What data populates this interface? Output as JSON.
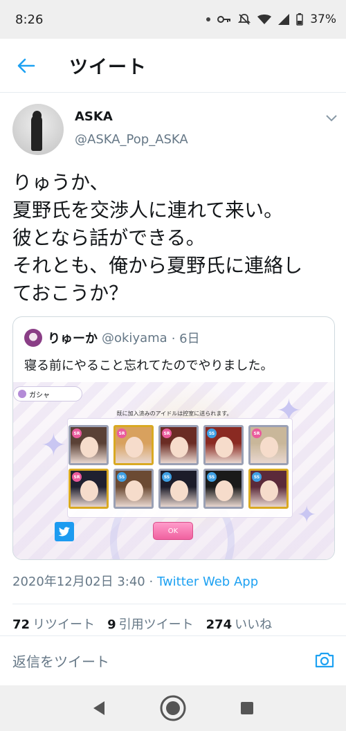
{
  "status_bar": {
    "time": "8:26",
    "battery": "37%"
  },
  "header": {
    "title": "ツイート"
  },
  "tweet": {
    "display_name": "ASKA",
    "handle": "@ASKA_Pop_ASKA",
    "lines": [
      "りゅうか、",
      "夏野氏を交渉人に連れて来い。",
      "彼となら話ができる。",
      "それとも、俺から夏野氏に連絡し",
      "ておこうか？"
    ],
    "timestamp": "2020年12月02日 3:40",
    "separator": " · ",
    "source": "Twitter Web App",
    "retweets_count": "72",
    "retweets_label": "リツイート",
    "quotes_count": "9",
    "quotes_label": "引用ツイート",
    "likes_count": "274",
    "likes_label": "いいね"
  },
  "quote": {
    "display_name": "りゅーか",
    "handle": "@okiyama",
    "age": "· 6日",
    "text": "寝る前にやること忘れてたのでやりました。",
    "image": {
      "tab_label": "ガシャ",
      "notice": "既に加入済みのアイドルは控室に送られます。",
      "ok_label": "OK",
      "cards": [
        {
          "badge": "SR",
          "frame": "silver",
          "hair": "#5a4136"
        },
        {
          "badge": "SR",
          "frame": "gold",
          "hair": "#d8a15e"
        },
        {
          "badge": "SR",
          "frame": "silver",
          "hair": "#6a2c24"
        },
        {
          "badge": "SS",
          "frame": "silver",
          "hair": "#8a2a22"
        },
        {
          "badge": "SR",
          "frame": "silver",
          "hair": "#c9b79a"
        },
        {
          "badge": "SR",
          "frame": "gold",
          "hair": "#1f2030"
        },
        {
          "badge": "SS",
          "frame": "silver",
          "hair": "#6b4a33"
        },
        {
          "badge": "SS",
          "frame": "silver",
          "hair": "#1c1c2a"
        },
        {
          "badge": "SS",
          "frame": "silver",
          "hair": "#1a1a1a"
        },
        {
          "badge": "SS",
          "frame": "gold",
          "hair": "#5b2a3a"
        }
      ]
    }
  },
  "reply": {
    "placeholder": "返信をツイート"
  },
  "colors": {
    "accent": "#1da1f2",
    "muted": "#657786",
    "text": "#14171a"
  }
}
